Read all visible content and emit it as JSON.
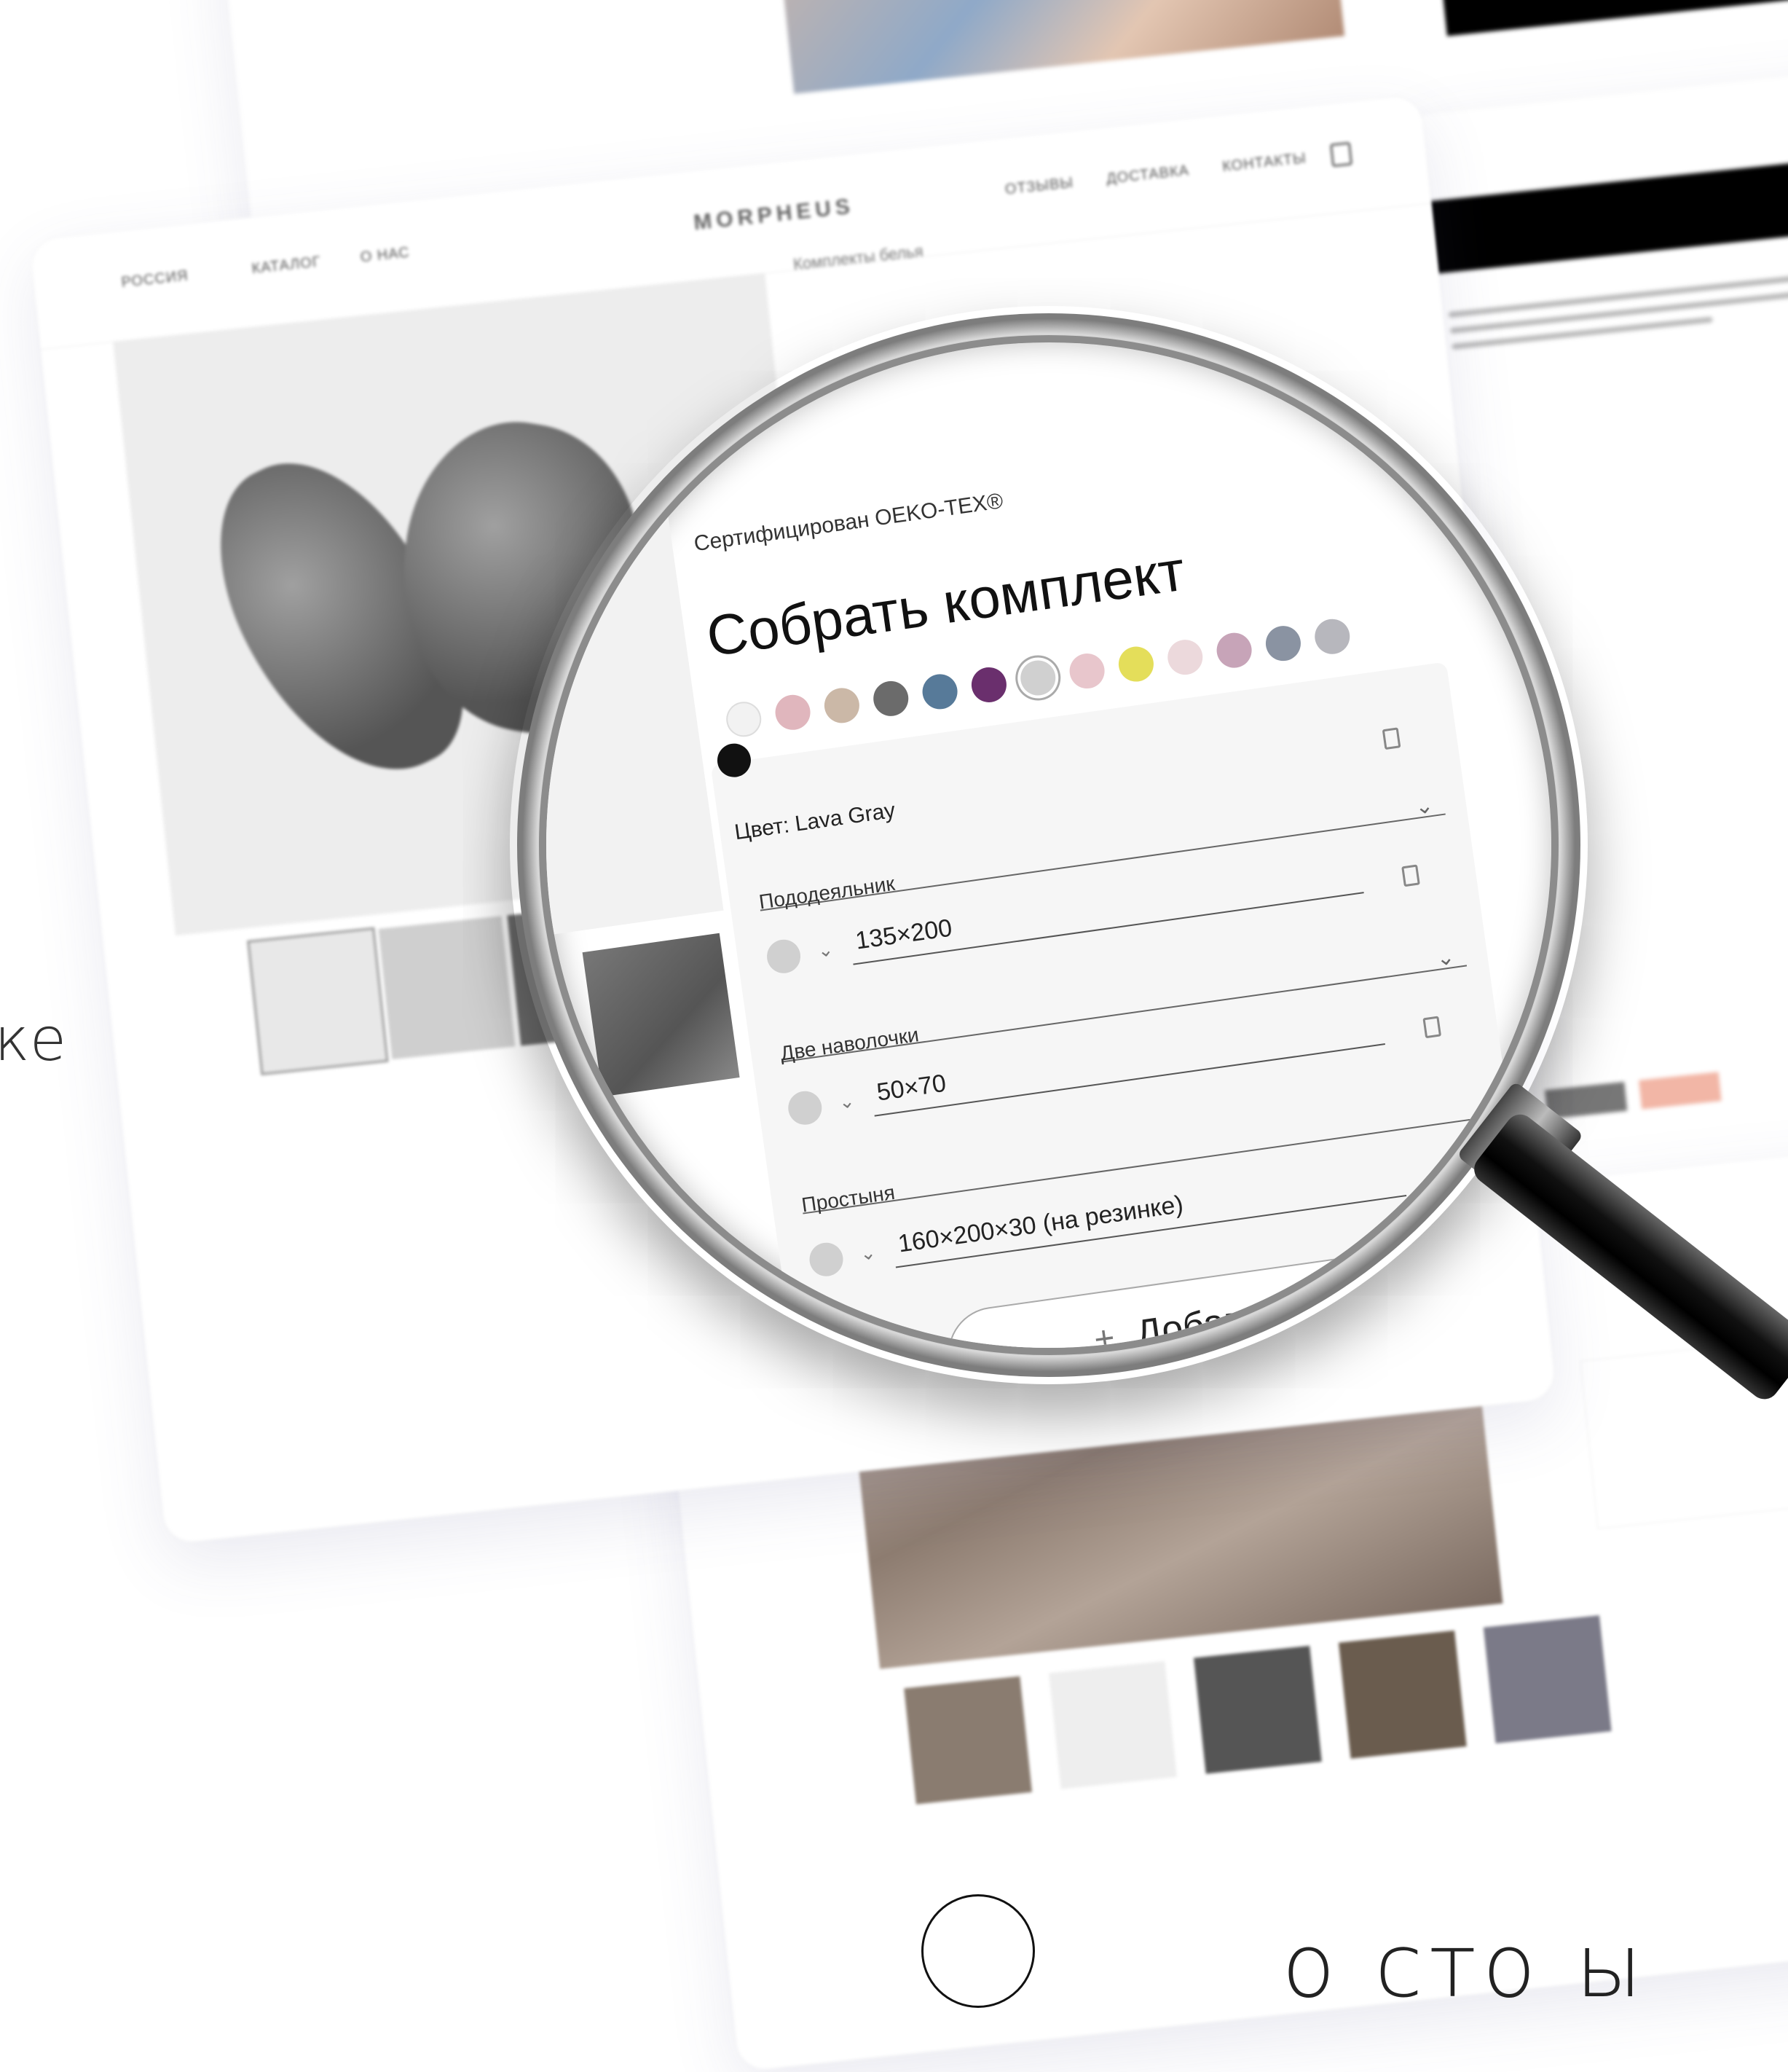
{
  "background": {
    "edge_text": "ке",
    "bottom_text": "o сто ы"
  },
  "site": {
    "logo": "MORPHEUS",
    "nav_left": [
      "РОССИЯ",
      "КАТАЛОГ",
      "О НАС"
    ],
    "nav_right": [
      "ОТЗЫВЫ",
      "ДОСТАВКА",
      "КОНТАКТЫ"
    ],
    "breadcrumb": "Комплекты белья"
  },
  "configurator": {
    "certificate": "Сертифицирован OEKO-TEX®",
    "title": "Собрать комплект",
    "colors": [
      "#f2f2f2",
      "#e0b6bd",
      "#cbb8a7",
      "#6b6b6b",
      "#577a99",
      "#6a2f6d",
      "#d0d0d0",
      "#e8c6cc",
      "#e4de5a",
      "#ecd9dc",
      "#c7a4b8",
      "#8a93a2",
      "#b7b7bd"
    ],
    "selected_color_index": 6,
    "extra_color": "#111111",
    "color_label": "Цвет: Lava Gray",
    "items": [
      {
        "title": "Пододеяльник",
        "size": "135×200"
      },
      {
        "title": "Две наволочки",
        "size": "50×70"
      },
      {
        "title": "Простыня",
        "size": "160×200×30 (на резинке)"
      }
    ],
    "add_more": "Добавить ещё"
  }
}
